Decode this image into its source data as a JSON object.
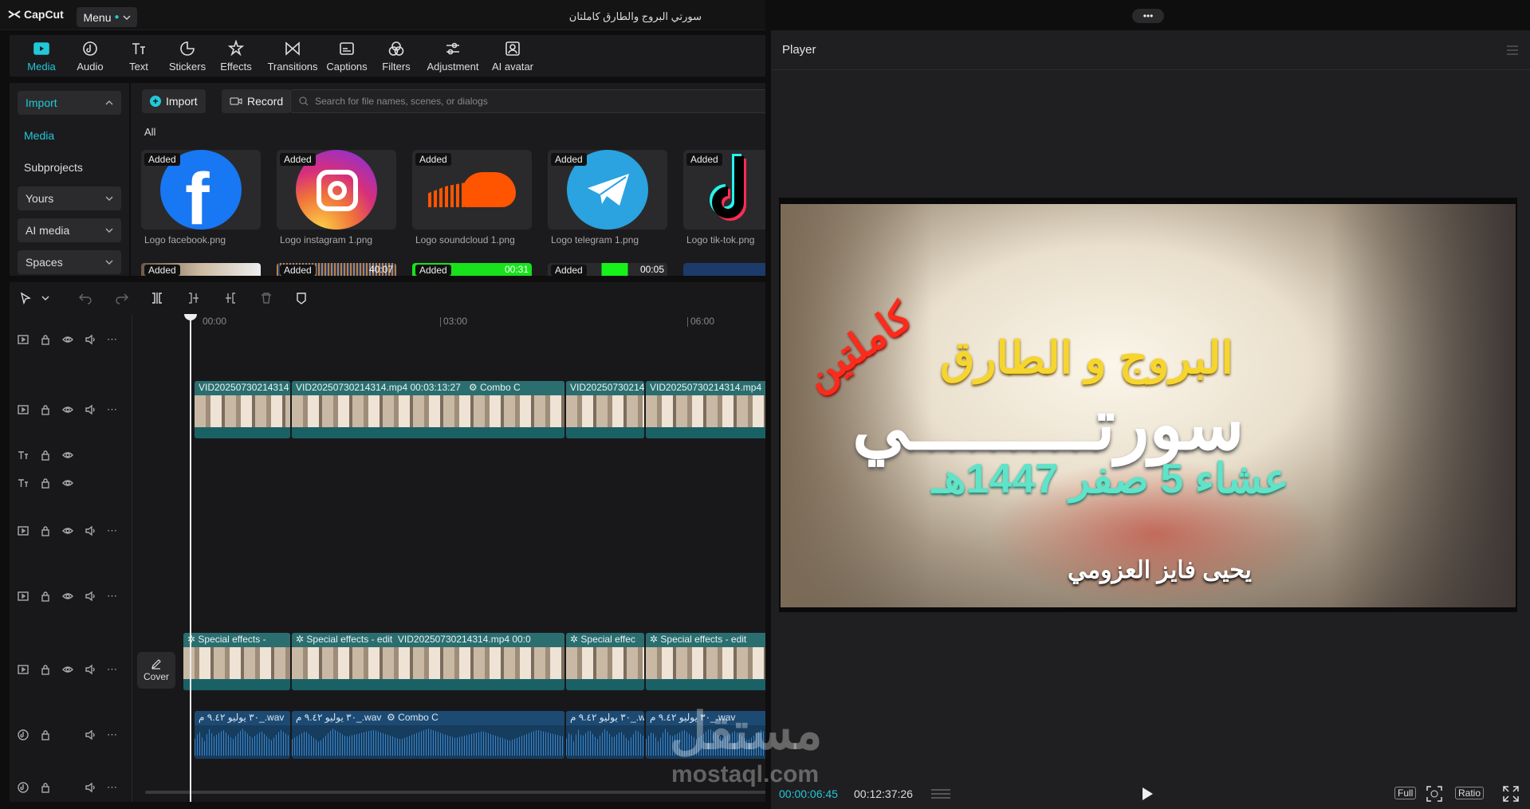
{
  "app": {
    "name": "CapCut",
    "menu_label": "Menu",
    "project_title": "سورتي البروج والطارق كاملتان",
    "more_dots": "•••"
  },
  "toolbar": {
    "tabs": [
      {
        "label": "Media",
        "icon": "media-icon",
        "active": true
      },
      {
        "label": "Audio",
        "icon": "audio-icon"
      },
      {
        "label": "Text",
        "icon": "text-icon"
      },
      {
        "label": "Stickers",
        "icon": "sticker-icon"
      },
      {
        "label": "Effects",
        "icon": "effects-icon"
      },
      {
        "label": "Transitions",
        "icon": "transitions-icon"
      },
      {
        "label": "Captions",
        "icon": "captions-icon"
      },
      {
        "label": "Filters",
        "icon": "filters-icon"
      },
      {
        "label": "Adjustment",
        "icon": "adjustment-icon"
      },
      {
        "label": "AI avatar",
        "icon": "ai-avatar-icon"
      }
    ]
  },
  "leftnav": {
    "import": "Import",
    "media": "Media",
    "subprojects": "Subprojects",
    "yours": "Yours",
    "ai_media": "AI media",
    "spaces": "Spaces"
  },
  "media": {
    "import_btn": "Import",
    "record_btn": "Record",
    "search_placeholder": "Search for file names, scenes, or dialogs",
    "filter_all": "All",
    "added_badge": "Added",
    "items": [
      {
        "name": "Logo facebook.png"
      },
      {
        "name": "Logo instagram 1.png"
      },
      {
        "name": "Logo soundcloud 1.png"
      },
      {
        "name": "Logo telegram 1.png"
      },
      {
        "name": "Logo tik-tok.png"
      }
    ],
    "strip_durations": [
      "40:07",
      "00:31",
      "00:05"
    ]
  },
  "timeline": {
    "ruler": [
      "00:00",
      "03:00",
      "06:00"
    ],
    "main_clips": [
      "VID20250730214314",
      "VID20250730214314.mp4   00:03:13:27",
      "Combo C",
      "VID20250730214",
      "VID20250730214314.mp4"
    ],
    "effect_clips": [
      "Special effects -",
      "Special effects - edit",
      "VID20250730214314.mp4   00:0",
      "Special effec",
      "Special effects - edit"
    ],
    "audio_clips": [
      "٣٠ يوليو ٩.٤٢ م_.wav",
      "٣٠ يوليو ٩.٤٢ م_.wav",
      "Combo C",
      "٣٠ يوليو ٩.٤٢ م_.wav",
      "٣٠ يوليو ٩.٤٢ م_.wav"
    ],
    "cover_label": "Cover"
  },
  "player": {
    "title": "Player",
    "overlay_title": "البروج  و الطارق",
    "overlay_complete": "كاملتين",
    "overlay_surah": "سورتـــــــــي",
    "overlay_date": "عشاء 5 صفر 1447هـ",
    "overlay_name": "يحيى فايز العزومي",
    "current_time": "00:00:06:45",
    "total_time": "00:12:37:26",
    "full_btn": "Full",
    "ratio_btn": "Ratio"
  },
  "watermark": {
    "ar": "مستقل",
    "en": "mostaql.com"
  },
  "colors": {
    "accent": "#22c8d8",
    "clip": "#1f5a5c",
    "audio": "#163c5e"
  }
}
